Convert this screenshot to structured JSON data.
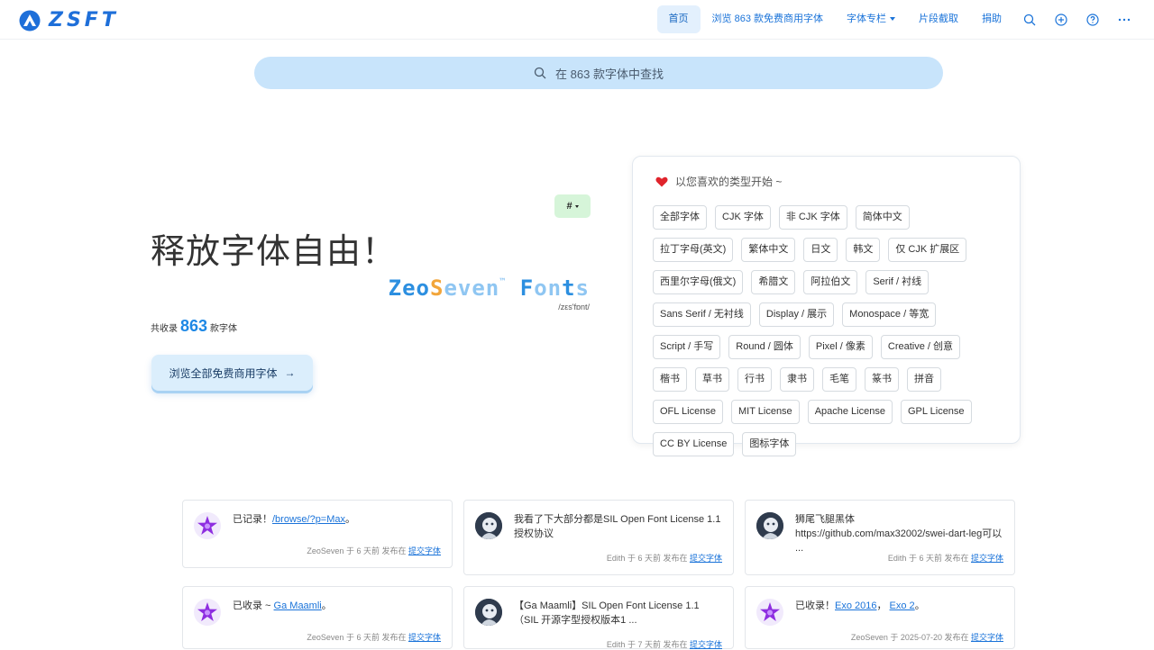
{
  "brand": {
    "logo_text": "ZSFT"
  },
  "nav": {
    "home": "首页",
    "browse": "浏览 863 款免费商用字体",
    "columns": "字体专栏",
    "snippet": "片段截取",
    "donate": "捐助"
  },
  "search": {
    "placeholder": "在 863 款字体中查找"
  },
  "hero": {
    "tag_button": "#",
    "title": "释放字体自由！",
    "brand_a": "Zeo",
    "brand_b": "S",
    "brand_c": "even",
    "brand_tm": "™",
    "brand_d": "F",
    "brand_e": "on",
    "brand_f": "t",
    "brand_g": "s",
    "phonetic": "/zεs'fɒnt/",
    "count_prefix": "共收录",
    "count_number": "863",
    "count_suffix": "款字体",
    "browse_button": "浏览全部免费商用字体",
    "browse_arrow": "→"
  },
  "categories": {
    "heading": "以您喜欢的类型开始 ~",
    "chips": [
      "全部字体",
      "CJK 字体",
      "非 CJK 字体",
      "简体中文",
      "拉丁字母(英文)",
      "繁体中文",
      "日文",
      "韩文",
      "仅 CJK 扩展区",
      "西里尔字母(俄文)",
      "希腊文",
      "阿拉伯文",
      "Serif / 衬线",
      "Sans Serif / 无衬线",
      "Display / 展示",
      "Monospace / 等宽",
      "Script / 手写",
      "Round / 圆体",
      "Pixel / 像素",
      "Creative / 创意",
      "楷书",
      "草书",
      "行书",
      "隶书",
      "毛笔",
      "篆书",
      "拼音",
      "OFL License",
      "MIT License",
      "Apache License",
      "GPL License",
      "CC BY License",
      "图标字体"
    ]
  },
  "posts": [
    {
      "text_a": "已记录！",
      "link": "/browse/?p=Max",
      "text_b": "。",
      "author": "ZeoSeven",
      "time": "于 6 天前 发布在",
      "where": "提交字体",
      "avatar": "star"
    },
    {
      "text_a": "我看了下大部分都是SIL Open Font License 1.1授权协议",
      "link": "",
      "text_b": "",
      "author": "Edith",
      "time": "于 6 天前 发布在",
      "where": "提交字体",
      "avatar": "photo"
    },
    {
      "text_a": "狮尾飞腿黑体 https://github.com/max32002/swei-dart-leg可以 ...",
      "link": "",
      "text_b": "",
      "author": "Edith",
      "time": "于 6 天前 发布在",
      "where": "提交字体",
      "avatar": "photo"
    },
    {
      "text_a": "已收录 ~ ",
      "link": "Ga Maamli",
      "text_b": "。",
      "author": "ZeoSeven",
      "time": "于 6 天前 发布在",
      "where": "提交字体",
      "avatar": "star"
    },
    {
      "text_a": "【Ga Maamli】SIL Open Font License 1.1（SIL 开源字型授权版本1 ...",
      "link": "",
      "text_b": "",
      "author": "Edith",
      "time": "于 7 天前 发布在",
      "where": "提交字体",
      "avatar": "photo"
    },
    {
      "text_a": "已收录！",
      "link": "Exo 2016",
      "text_b": "，",
      "link2": "Exo 2",
      "text_c": "。",
      "author": "ZeoSeven",
      "time": "于 2025-07-20 发布在",
      "where": "提交字体",
      "avatar": "star"
    }
  ],
  "colors": {
    "accent": "#1a73d9",
    "search_bg": "#c8e4fb",
    "tag_bg": "#d6f5d9"
  }
}
